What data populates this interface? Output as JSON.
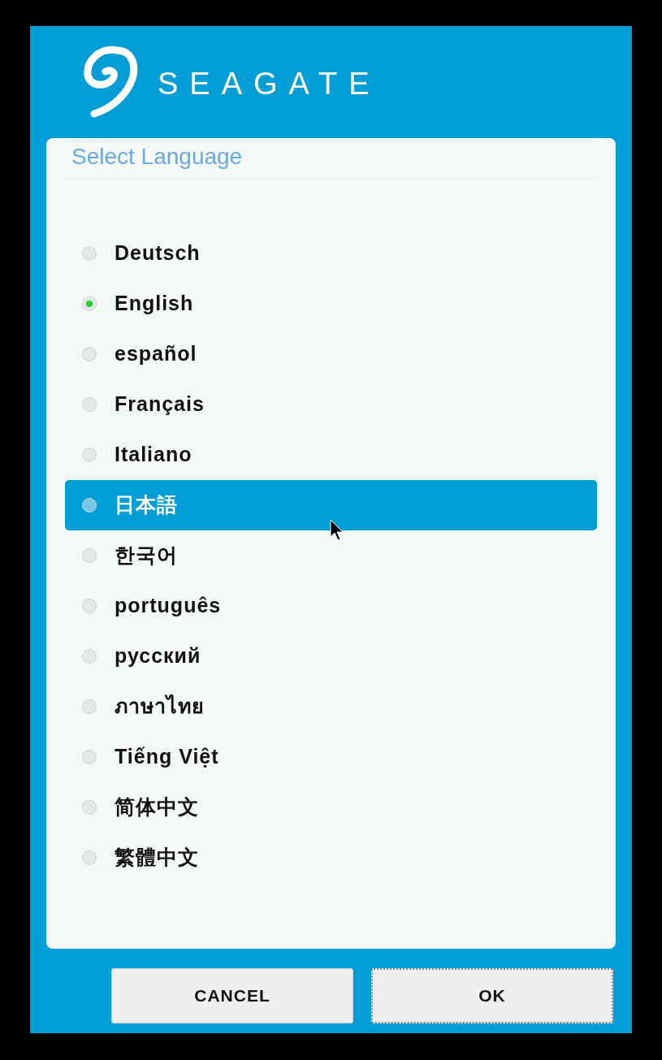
{
  "brand": {
    "name": "SEAGATE"
  },
  "dialog": {
    "title": "Select Language",
    "languages": [
      {
        "label": "Deutsch",
        "selected": false,
        "highlighted": false
      },
      {
        "label": "English",
        "selected": true,
        "highlighted": false
      },
      {
        "label": "español",
        "selected": false,
        "highlighted": false
      },
      {
        "label": "Français",
        "selected": false,
        "highlighted": false
      },
      {
        "label": "Italiano",
        "selected": false,
        "highlighted": false
      },
      {
        "label": "日本語",
        "selected": false,
        "highlighted": true
      },
      {
        "label": "한국어",
        "selected": false,
        "highlighted": false
      },
      {
        "label": "português",
        "selected": false,
        "highlighted": false
      },
      {
        "label": "русский",
        "selected": false,
        "highlighted": false
      },
      {
        "label": "ภาษาไทย",
        "selected": false,
        "highlighted": false
      },
      {
        "label": "Tiếng Việt",
        "selected": false,
        "highlighted": false
      },
      {
        "label": "简体中文",
        "selected": false,
        "highlighted": false
      },
      {
        "label": "繁體中文",
        "selected": false,
        "highlighted": false
      }
    ]
  },
  "buttons": [
    {
      "label": "CANCEL",
      "focused": false
    },
    {
      "label": "OK",
      "focused": true
    }
  ]
}
